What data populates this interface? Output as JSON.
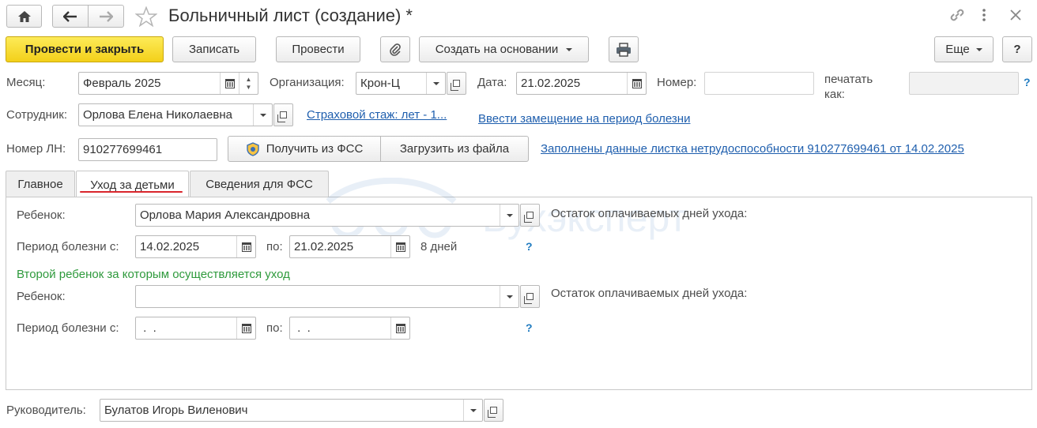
{
  "window": {
    "title": "Больничный лист (создание) *"
  },
  "toolbar": {
    "post_close": "Провести и закрыть",
    "save": "Записать",
    "post": "Провести",
    "create_based": "Создать на основании",
    "more": "Еще",
    "help": "?"
  },
  "header": {
    "month_label": "Месяц:",
    "month_value": "Февраль 2025",
    "org_label": "Организация:",
    "org_value": "Крон-Ц",
    "date_label": "Дата:",
    "date_value": "21.02.2025",
    "number_label": "Номер:",
    "number_value": "",
    "print_as_label_1": "печатать",
    "print_as_label_2": "как:",
    "print_as_value": "",
    "print_help": "?",
    "employee_label": "Сотрудник:",
    "employee_value": "Орлова Елена Николаевна",
    "insurance_link": "Страховой стаж: лет - 1...",
    "replacement_link": "Ввести замещение на период болезни",
    "ln_label": "Номер ЛН:",
    "ln_value": "910277699461",
    "get_fss": "Получить из ФСС",
    "load_file": "Загрузить из файла",
    "filled_link": "Заполнены данные листка нетрудоспособности 910277699461 от 14.02.2025"
  },
  "tabs": [
    {
      "label": "Главное"
    },
    {
      "label": "Уход за детьми"
    },
    {
      "label": "Сведения для ФСС"
    }
  ],
  "care": {
    "child1_label": "Ребенок:",
    "child1_value": "Орлова Мария Александровна",
    "child1_rest_label": "Остаток оплачиваемых дней ухода:",
    "period1_label": "Период болезни с:",
    "period1_from": "14.02.2025",
    "period1_to_label": "по:",
    "period1_to": "21.02.2025",
    "period1_days": "8 дней",
    "period1_help": "?",
    "second_child_caption": "Второй ребенок за которым осуществляется уход",
    "child2_label": "Ребенок:",
    "child2_value": "",
    "child2_rest_label": "Остаток оплачиваемых дней ухода:",
    "period2_label": "Период болезни с:",
    "period2_from": " .  .",
    "period2_to_label": "по:",
    "period2_to": " .  .",
    "period2_help": "?"
  },
  "footer": {
    "manager_label": "Руководитель:",
    "manager_value": "Булатов Игорь Виленович"
  },
  "watermark": "Бухэксперт",
  "colors": {
    "accent_yellow": "#f3d01a",
    "link_blue": "#1f5fae",
    "caption_green": "#2e9a3c",
    "active_tab_underline": "#d9262c"
  }
}
